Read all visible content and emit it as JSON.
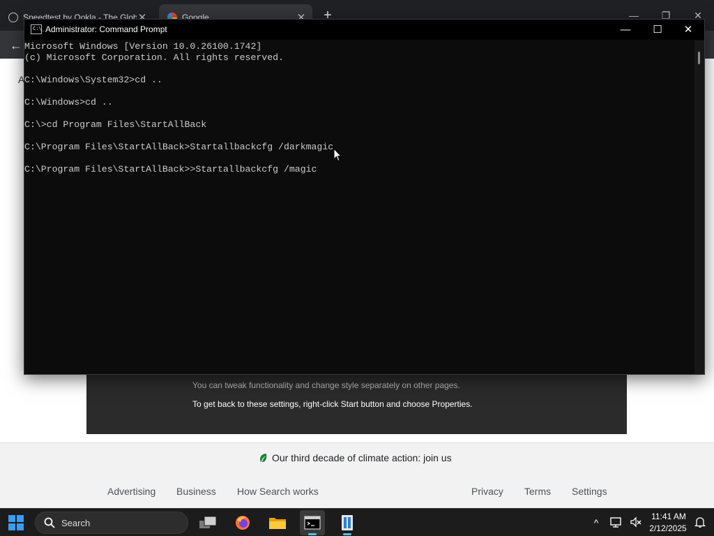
{
  "browser": {
    "tabs": [
      {
        "title": "Speedtest by Ookla - The Glob",
        "close": "✕"
      },
      {
        "title": "Google",
        "close": "✕"
      }
    ],
    "new_tab": "+",
    "window_controls": {
      "minimize": "—",
      "restore": "❐",
      "close": "✕"
    },
    "back": "←"
  },
  "page": {
    "partial_letter": "A",
    "tips": [
      "You can tweak functionality and change style separately on other pages.",
      "To get back to these settings, right-click Start button and choose Properties."
    ],
    "climate_text": "Our third decade of climate action: join us",
    "footer_left": [
      "Advertising",
      "Business",
      "How Search works"
    ],
    "footer_right": [
      "Privacy",
      "Terms",
      "Settings"
    ]
  },
  "cmd": {
    "title": "Administrator: Command Prompt",
    "icon_text": "C:\\_",
    "controls": {
      "minimize": "—",
      "maximize": "☐",
      "close": "✕"
    },
    "lines": [
      "Microsoft Windows [Version 10.0.26100.1742]",
      "(c) Microsoft Corporation. All rights reserved.",
      "",
      "C:\\Windows\\System32>cd ..",
      "",
      "C:\\Windows>cd ..",
      "",
      "C:\\>cd Program Files\\StartAllBack",
      "",
      "C:\\Program Files\\StartAllBack>Startallbackcfg /darkmagic",
      "",
      "C:\\Program Files\\StartAllBack>>Startallbackcfg /magic"
    ]
  },
  "taskbar": {
    "search_label": "Search",
    "apps": [
      "task-view",
      "firefox",
      "file-explorer",
      "command-prompt",
      "startallback"
    ],
    "tray_chevron": "^",
    "time": "11:41 AM",
    "date": "2/12/2025",
    "accent_color": "#4cc2ff"
  }
}
